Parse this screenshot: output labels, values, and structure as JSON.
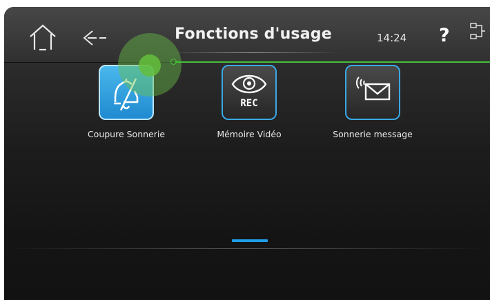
{
  "header": {
    "title": "Fonctions d'usage",
    "time": "14:24",
    "help_label": "?",
    "home_icon": "home-icon",
    "back_icon": "back-arrow-icon",
    "network_icon": "network-icon"
  },
  "functions": [
    {
      "label": "Coupure Sonnerie",
      "icon": "ringer-off-icon",
      "selected": true
    },
    {
      "label": "Mémoire Vidéo",
      "icon": "eye-rec-icon",
      "icon_text": "REC",
      "selected": false
    },
    {
      "label": "Sonnerie message",
      "icon": "message-envelope-icon",
      "selected": false
    }
  ],
  "pagination": {
    "current_page": 1
  },
  "colors": {
    "accent": "#1f9ee6",
    "touch_indicator": "#45c23a",
    "tile_active": "#3aa8e4",
    "background": "#1d1d1d"
  }
}
